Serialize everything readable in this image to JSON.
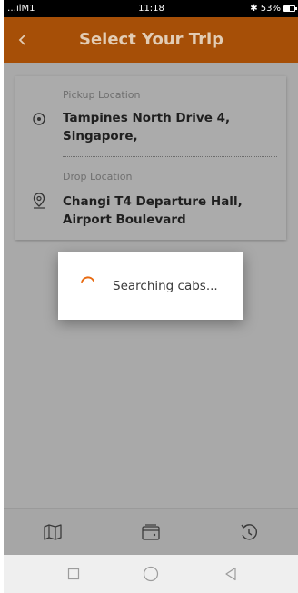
{
  "status_bar": {
    "carrier": "…ılM1",
    "time": "11:18",
    "battery": "✱ 53%"
  },
  "app_bar": {
    "title": "Select Your Trip",
    "back_icon": "chevron-left-icon"
  },
  "trip": {
    "pickup_label": "Pickup Location",
    "pickup_line1": "Tampines North Drive 4,",
    "pickup_line2": "Singapore,",
    "drop_label": "Drop Location",
    "drop_line1": "Changi T4 Departure Hall,",
    "drop_line2": "Airport Boulevard"
  },
  "dialog": {
    "message": "Searching cabs..."
  },
  "bottom_nav": {
    "items": [
      "map-icon",
      "wallet-icon",
      "history-icon"
    ]
  },
  "colors": {
    "accent": "#a64f07",
    "spinner": "#e86a10",
    "title": "#e2ccb4",
    "overlay_bg": "#a9a9a9"
  }
}
